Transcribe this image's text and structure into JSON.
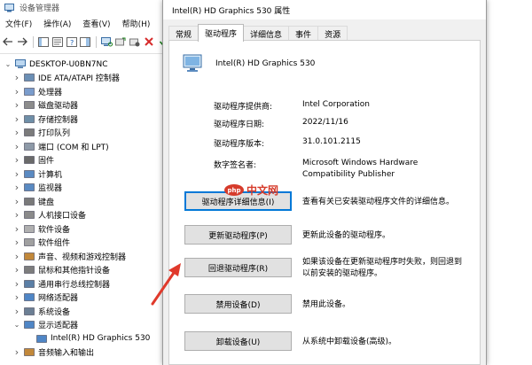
{
  "device_manager": {
    "title": "设备管理器",
    "menu": [
      "文件(F)",
      "操作(A)",
      "查看(V)",
      "帮助(H)"
    ],
    "tree": {
      "root": "DESKTOP-U0BN7NC",
      "items": [
        {
          "label": "IDE ATA/ATAPI 控制器",
          "icon": "ide-controller-icon"
        },
        {
          "label": "处理器",
          "icon": "processor-icon"
        },
        {
          "label": "磁盘驱动器",
          "icon": "disk-drive-icon"
        },
        {
          "label": "存储控制器",
          "icon": "storage-controller-icon"
        },
        {
          "label": "打印队列",
          "icon": "printer-icon"
        },
        {
          "label": "端口 (COM 和 LPT)",
          "icon": "port-icon"
        },
        {
          "label": "固件",
          "icon": "firmware-icon"
        },
        {
          "label": "计算机",
          "icon": "computer-icon"
        },
        {
          "label": "监视器",
          "icon": "monitor-icon"
        },
        {
          "label": "键盘",
          "icon": "keyboard-icon"
        },
        {
          "label": "人机接口设备",
          "icon": "hid-icon"
        },
        {
          "label": "软件设备",
          "icon": "software-device-icon"
        },
        {
          "label": "软件组件",
          "icon": "software-component-icon"
        },
        {
          "label": "声音、视频和游戏控制器",
          "icon": "sound-icon"
        },
        {
          "label": "鼠标和其他指针设备",
          "icon": "mouse-icon"
        },
        {
          "label": "通用串行总线控制器",
          "icon": "usb-icon"
        },
        {
          "label": "网络适配器",
          "icon": "network-icon"
        },
        {
          "label": "系统设备",
          "icon": "system-device-icon"
        },
        {
          "label": "显示适配器",
          "icon": "display-adapter-icon",
          "expanded": true
        },
        {
          "label": "Intel(R) HD Graphics 530",
          "icon": "display-adapter-icon",
          "child": true
        },
        {
          "label": "音频输入和输出",
          "icon": "audio-icon"
        }
      ]
    }
  },
  "dialog": {
    "title": "Intel(R) HD Graphics 530 属性",
    "tabs": [
      "常规",
      "驱动程序",
      "详细信息",
      "事件",
      "资源"
    ],
    "active_tab": "驱动程序",
    "device_name": "Intel(R) HD Graphics 530",
    "info": {
      "provider_label": "驱动程序提供商:",
      "provider_value": "Intel Corporation",
      "date_label": "驱动程序日期:",
      "date_value": "2022/11/16",
      "version_label": "驱动程序版本:",
      "version_value": "31.0.101.2115",
      "signer_label": "数字签名者:",
      "signer_value": "Microsoft Windows Hardware Compatibility Publisher"
    },
    "actions": [
      {
        "label": "驱动程序详细信息(I)",
        "desc": "查看有关已安装驱动程序文件的详细信息。"
      },
      {
        "label": "更新驱动程序(P)",
        "desc": "更新此设备的驱动程序。"
      },
      {
        "label": "回退驱动程序(R)",
        "desc": "如果该设备在更新驱动程序时失败，则回退到以前安装的驱动程序。"
      },
      {
        "label": "禁用设备(D)",
        "desc": "禁用此设备。"
      },
      {
        "label": "卸载设备(U)",
        "desc": "从系统中卸载设备(高级)。"
      }
    ]
  },
  "watermark": {
    "badge": "php",
    "text": "中文网"
  },
  "colors": {
    "accent": "#0078d7",
    "arrow": "#e0392b",
    "watermark": "#d63b2b"
  }
}
